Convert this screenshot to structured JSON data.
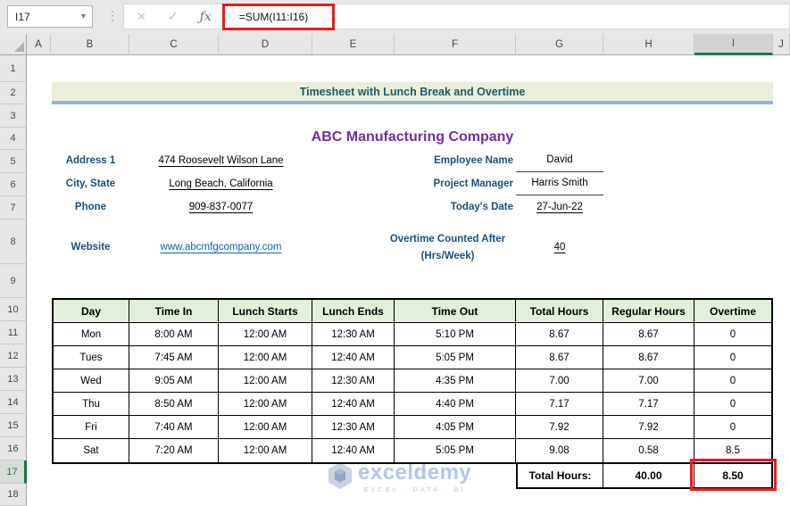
{
  "formula_bar": {
    "name_box": "I17",
    "caret_glyph": "▾",
    "dots_glyph": "⋮",
    "cancel_glyph": "✕",
    "enter_glyph": "✓",
    "fx_glyph": "ƒx",
    "formula": "=SUM(I11:I16)"
  },
  "grid": {
    "columns": [
      "A",
      "B",
      "C",
      "D",
      "E",
      "F",
      "G",
      "H",
      "I",
      "J"
    ],
    "rows": [
      "1",
      "2",
      "3",
      "4",
      "5",
      "6",
      "7",
      "8",
      "9",
      "10",
      "11",
      "12",
      "13",
      "14",
      "15",
      "16",
      "17",
      "18"
    ],
    "selected_column": "I",
    "selected_row": "17",
    "selected_cell": "I17"
  },
  "sheet": {
    "banner_title": "Timesheet with Lunch Break and Overtime",
    "company_name": "ABC Manufacturing Company",
    "info_left": [
      {
        "label": "Address 1",
        "value": "474 Roosevelt Wilson Lane"
      },
      {
        "label": "City, State",
        "value": "Long Beach, California"
      },
      {
        "label": "Phone",
        "value": "909-837-0077"
      },
      {
        "label": "Website",
        "value": "www.abcmfgcompany.com"
      }
    ],
    "info_right": [
      {
        "label": "Employee Name",
        "value": "David"
      },
      {
        "label": "Project Manager",
        "value": "Harris Smith"
      },
      {
        "label": "Today's Date",
        "value": "27-Jun-22"
      },
      {
        "label": "Overtime Counted After (Hrs/Week)",
        "value": "40"
      }
    ]
  },
  "timesheet": {
    "headers": [
      "Day",
      "Time In",
      "Lunch Starts",
      "Lunch Ends",
      "Time Out",
      "Total Hours",
      "Regular Hours",
      "Overtime"
    ],
    "rows": [
      [
        "Mon",
        "8:00 AM",
        "12:00 AM",
        "12:30 AM",
        "5:10 PM",
        "8.67",
        "8.67",
        "0"
      ],
      [
        "Tues",
        "7:45 AM",
        "12:00 AM",
        "12:40 AM",
        "5:05 PM",
        "8.67",
        "8.67",
        "0"
      ],
      [
        "Wed",
        "9:05 AM",
        "12:00 AM",
        "12:30 AM",
        "4:35 PM",
        "7.00",
        "7.00",
        "0"
      ],
      [
        "Thu",
        "8:50 AM",
        "12:00 AM",
        "12:40 AM",
        "4:40 PM",
        "7.17",
        "7.17",
        "0"
      ],
      [
        "Fri",
        "7:40 AM",
        "12:00 AM",
        "12:30 AM",
        "4:05 PM",
        "7.92",
        "7.92",
        "0"
      ],
      [
        "Sat",
        "7:20 AM",
        "12:00 AM",
        "12:40 AM",
        "5:05 PM",
        "9.08",
        "0.58",
        "8.5"
      ]
    ],
    "total_label": "Total Hours:",
    "total_regular_hours": "40.00",
    "total_overtime": "8.50"
  },
  "watermark": {
    "brand": "exceldemy",
    "tagline": "EXCEL · DATA · BI"
  },
  "colors": {
    "banner_bg": "#E9EFDA",
    "banner_border": "#95B3D7",
    "banner_text": "#215968",
    "company_text": "#7030A0",
    "label_text": "#1F4E79",
    "link_text": "#0563C1",
    "table_header_bg": "#E2EFDA",
    "selection_green": "#217346",
    "annotation_red": "#E51C1C",
    "watermark_blue": "#B5C5E8"
  }
}
